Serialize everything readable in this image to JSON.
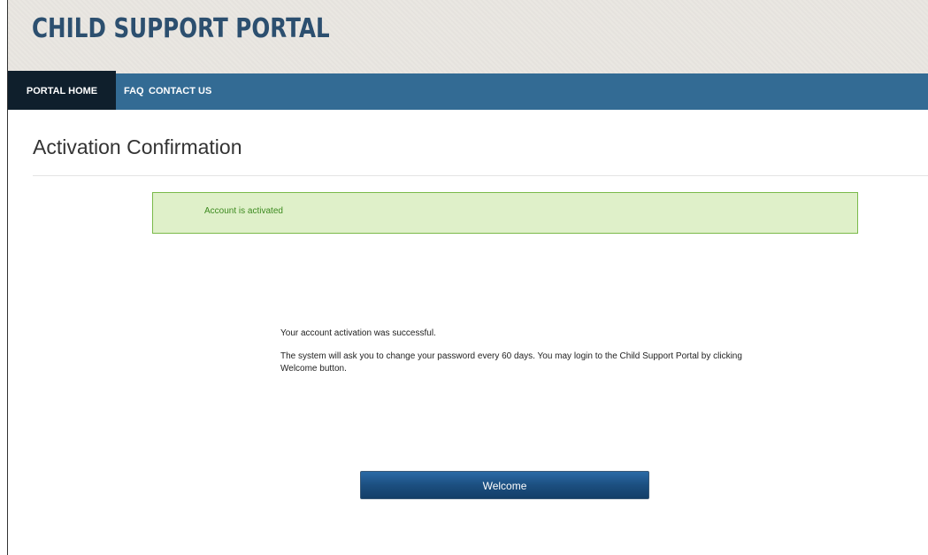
{
  "header": {
    "brand": "CHILD SUPPORT PORTAL"
  },
  "nav": {
    "items": [
      {
        "label": "PORTAL HOME",
        "active": true
      },
      {
        "label": "FAQ",
        "active": false
      },
      {
        "label": "CONTACT US",
        "active": false
      }
    ]
  },
  "main": {
    "title": "Activation Confirmation",
    "alert": "Account is activated",
    "message_line1": "Your account activation was successful.",
    "message_line2": "The system will ask you to change your password every 60 days. You may login to the Child Support Portal by clicking Welcome button.",
    "button_label": "Welcome"
  },
  "colors": {
    "nav_bg": "#336b94",
    "nav_active_bg": "#0f1f2c",
    "brand_text": "#2c4f6f",
    "alert_bg": "#dff0c9",
    "alert_border": "#7aba4a",
    "alert_text": "#3c8a1f",
    "button_bg": "#1c4f80"
  }
}
